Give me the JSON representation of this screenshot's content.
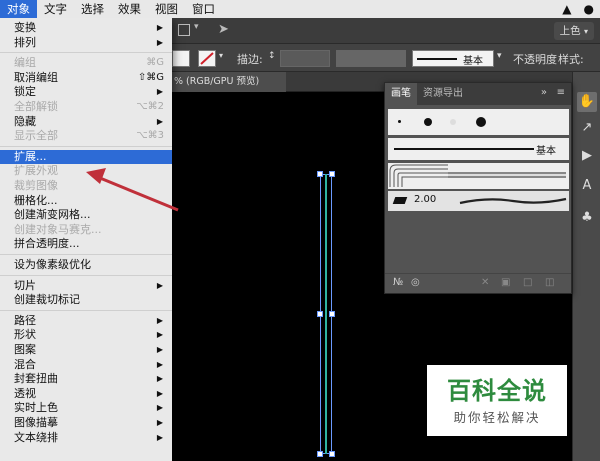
{
  "menubar": {
    "items": [
      "对象",
      "文字",
      "选择",
      "效果",
      "视图",
      "窗口"
    ],
    "active_index": 0,
    "right_icons": [
      "bell-icon",
      "user-icon"
    ]
  },
  "appbar": {
    "workspace_label": "上色"
  },
  "control_bar": {
    "stroke_label": "描边:",
    "brush_label": "基本",
    "opacity_label": "不透明度",
    "style_label": "样式:"
  },
  "document": {
    "tab_label": "% (RGB/GPU 预览)"
  },
  "brush_panel": {
    "tabs": [
      "画笔",
      "资源导出"
    ],
    "basic_label": "基本",
    "size_label": "2.00"
  },
  "menu": {
    "items": [
      {
        "label": "变换",
        "submenu": true,
        "disabled": false
      },
      {
        "label": "排列",
        "submenu": true,
        "disabled": false
      },
      {
        "label": "编组",
        "shortcut": "⌘G",
        "disabled": true
      },
      {
        "label": "取消编组",
        "shortcut": "⇧⌘G",
        "disabled": false
      },
      {
        "label": "锁定",
        "submenu": true,
        "disabled": false
      },
      {
        "label": "全部解锁",
        "shortcut": "⌥⌘2",
        "disabled": true
      },
      {
        "label": "隐藏",
        "submenu": true,
        "disabled": false
      },
      {
        "label": "显示全部",
        "shortcut": "⌥⌘3",
        "disabled": true
      },
      {
        "label": "扩展...",
        "disabled": false,
        "highlight": true
      },
      {
        "label": "扩展外观",
        "disabled": true
      },
      {
        "label": "裁剪图像",
        "disabled": true
      },
      {
        "label": "栅格化...",
        "disabled": false
      },
      {
        "label": "创建渐变网格...",
        "disabled": false
      },
      {
        "label": "创建对象马赛克...",
        "disabled": true
      },
      {
        "label": "拼合透明度...",
        "disabled": false
      },
      {
        "label": "设为像素级优化",
        "disabled": false
      },
      {
        "label": "切片",
        "submenu": true,
        "disabled": false
      },
      {
        "label": "创建裁切标记",
        "disabled": false
      },
      {
        "label": "路径",
        "submenu": true,
        "disabled": false
      },
      {
        "label": "形状",
        "submenu": true,
        "disabled": false
      },
      {
        "label": "图案",
        "submenu": true,
        "disabled": false
      },
      {
        "label": "混合",
        "submenu": true,
        "disabled": false
      },
      {
        "label": "封套扭曲",
        "submenu": true,
        "disabled": false
      },
      {
        "label": "透视",
        "submenu": true,
        "disabled": false
      },
      {
        "label": "实时上色",
        "submenu": true,
        "disabled": false
      },
      {
        "label": "图像描摹",
        "submenu": true,
        "disabled": false
      },
      {
        "label": "文本绕排",
        "submenu": true,
        "disabled": false
      }
    ]
  },
  "watermark": {
    "title": "百科全说",
    "subtitle": "助你轻松解决"
  },
  "colors": {
    "highlight": "#2d6bd6",
    "arrow": "#c0303a",
    "watermark_green": "#2e8b3e"
  }
}
